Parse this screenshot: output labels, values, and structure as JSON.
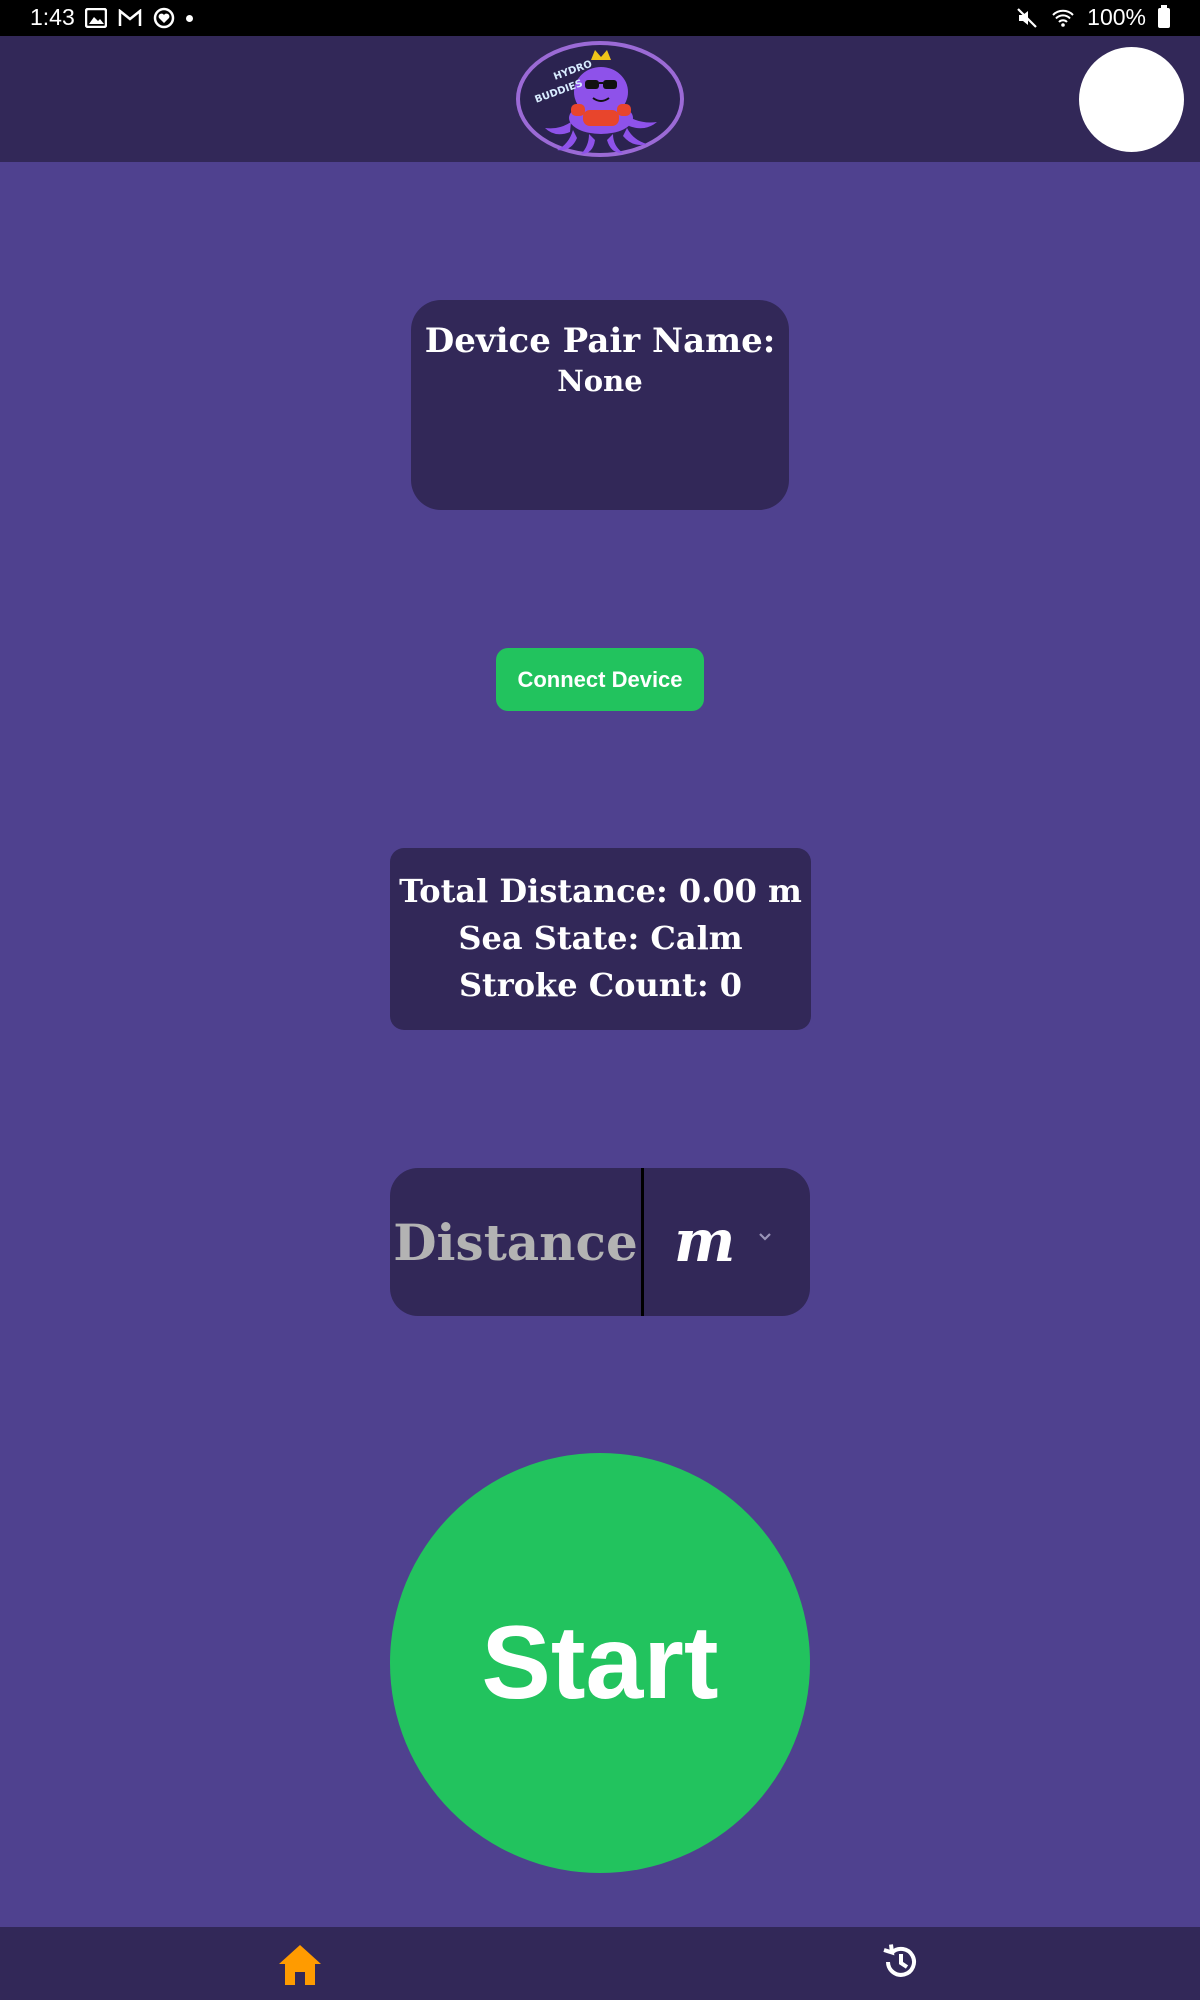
{
  "status_bar": {
    "time": "1:43",
    "battery": "100%",
    "left_icons": [
      "image-icon",
      "gmail-icon",
      "heart-circle-icon",
      "dot-icon"
    ],
    "right_icons": [
      "mute-icon",
      "wifi-icon",
      "battery-icon"
    ]
  },
  "header": {
    "logo_icon": "octopus-logo-icon",
    "avatar": "profile-avatar"
  },
  "device": {
    "title": "Device Pair Name:",
    "value": "None"
  },
  "connect": {
    "label": "Connect Device"
  },
  "stats": {
    "total_distance": "Total Distance: 0.00 m",
    "sea_state": "Sea State: Calm",
    "stroke_count": "Stroke Count: 0"
  },
  "distance_input": {
    "placeholder": "Distance",
    "value": "",
    "unit_selected": "m"
  },
  "start": {
    "label": "Start"
  },
  "bottom_nav": {
    "items": [
      {
        "icon": "home-icon",
        "active": true
      },
      {
        "icon": "history-icon",
        "active": false
      }
    ]
  },
  "colors": {
    "background": "#4f418f",
    "card": "#322858",
    "accent_green": "#22c35e",
    "active_nav": "#ff9b00"
  }
}
